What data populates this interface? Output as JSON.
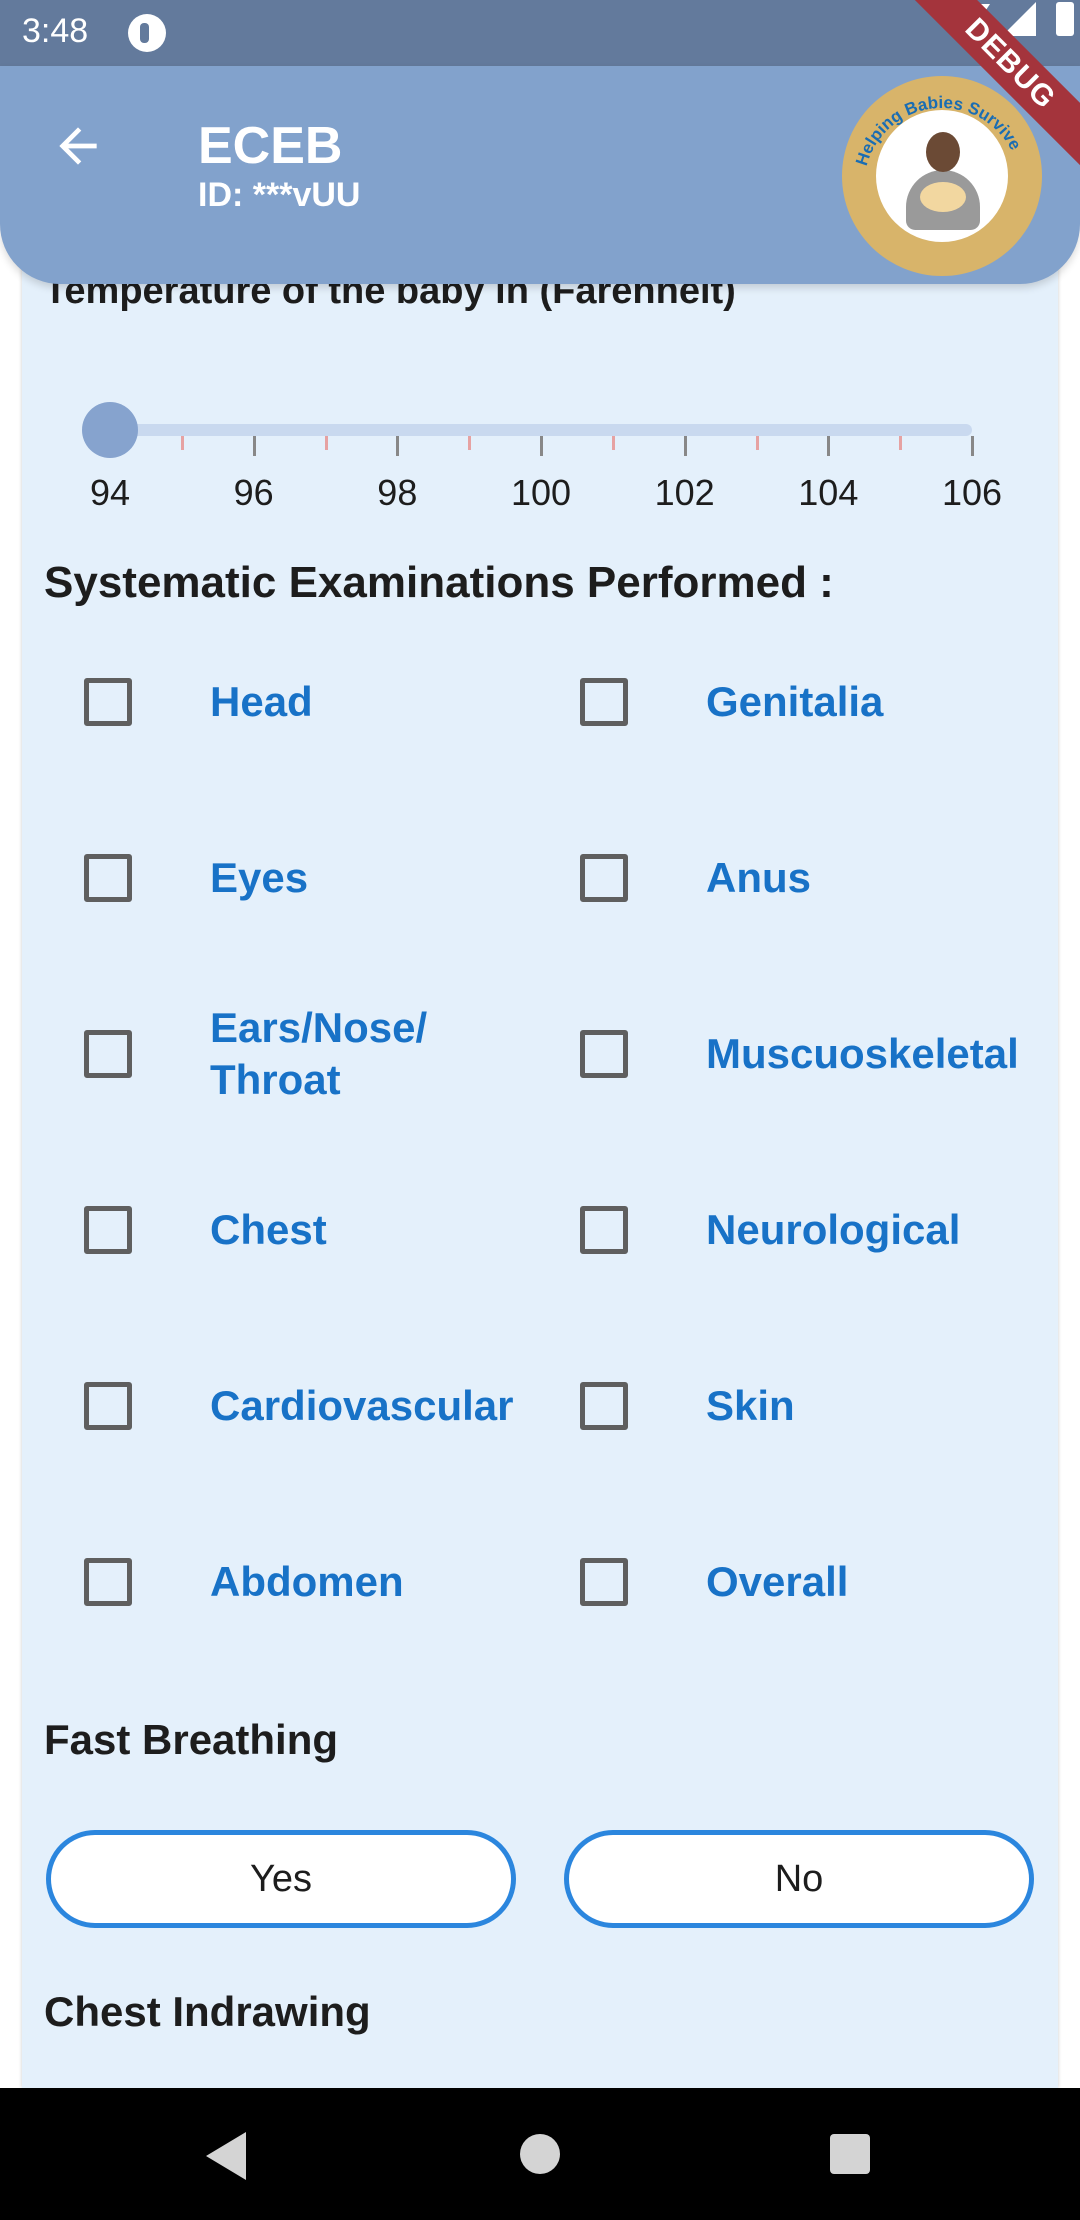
{
  "status_bar": {
    "time": "3:48",
    "icons": [
      "app-notification-icon",
      "wifi-icon",
      "signal-icon",
      "battery-icon"
    ]
  },
  "app_bar": {
    "title": "ECEB",
    "subtitle": "ID: ***vUU",
    "back_icon": "arrow-left-icon",
    "logo_text": "Helping Babies Survive",
    "debug_banner": "DEBUG",
    "background_color": "#82a2cc"
  },
  "temperature": {
    "label": "Temperature of the baby in (Farenheit)",
    "min": 94,
    "max": 106,
    "value": 94,
    "tick_labels": [
      "94",
      "96",
      "98",
      "100",
      "102",
      "104",
      "106"
    ]
  },
  "examinations": {
    "title": "Systematic Examinations Performed :",
    "left_column": [
      {
        "label": "Head",
        "checked": false
      },
      {
        "label": "Eyes",
        "checked": false
      },
      {
        "label": "Ears/Nose/ Throat",
        "checked": false
      },
      {
        "label": "Chest",
        "checked": false
      },
      {
        "label": "Cardiovascular",
        "checked": false
      },
      {
        "label": "Abdomen",
        "checked": false
      }
    ],
    "right_column": [
      {
        "label": "Genitalia",
        "checked": false
      },
      {
        "label": "Anus",
        "checked": false
      },
      {
        "label": "Muscuoskeletal",
        "checked": false
      },
      {
        "label": "Neurological",
        "checked": false
      },
      {
        "label": "Skin",
        "checked": false
      },
      {
        "label": "Overall",
        "checked": false
      }
    ]
  },
  "fast_breathing": {
    "title": "Fast Breathing",
    "yes_label": "Yes",
    "no_label": "No"
  },
  "chest_indrawing": {
    "title": "Chest Indrawing"
  },
  "colors": {
    "accent_blue": "#1872c7",
    "button_border": "#2b86de",
    "card_background": "#e4f0fb"
  }
}
